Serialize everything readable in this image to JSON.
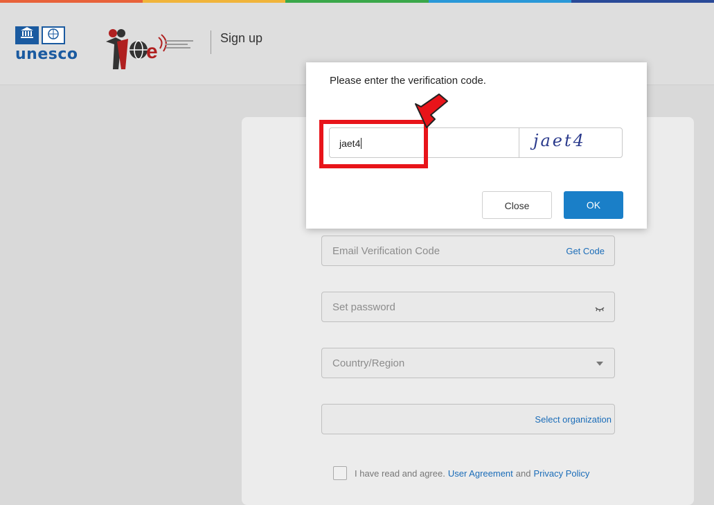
{
  "header": {
    "brand_left": "unesco",
    "page_title": "Sign up",
    "accent_colors": [
      "#e8623a",
      "#f0b43a",
      "#3aa84a",
      "#2a98d8",
      "#2a4a98"
    ]
  },
  "form": {
    "email_code_placeholder": "Email Verification Code",
    "get_code_label": "Get Code",
    "password_placeholder": "Set password",
    "country_placeholder": "Country/Region",
    "select_org_label": "Select organization",
    "agree_text": "I have read and agree.",
    "user_agreement": "User Agreement",
    "and_text": "and",
    "privacy_policy": "Privacy Policy"
  },
  "modal": {
    "message": "Please enter the verification code.",
    "input_value": "jaet4",
    "captcha_text": "jaet4",
    "close_label": "Close",
    "ok_label": "OK"
  }
}
